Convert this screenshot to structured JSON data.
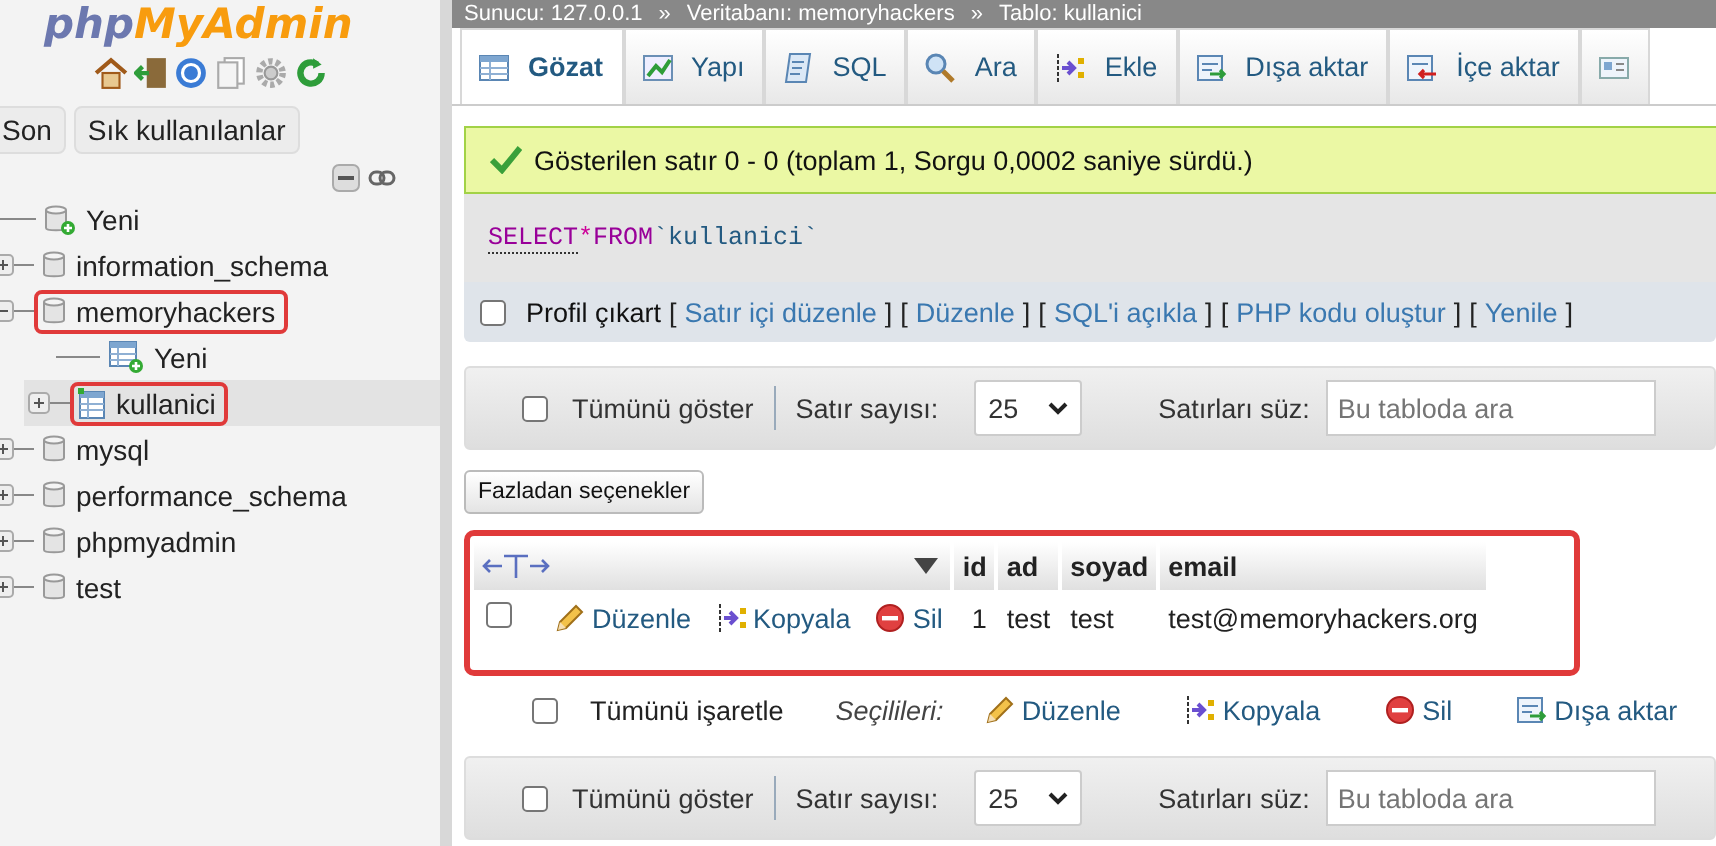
{
  "logo": [
    "php",
    "MyAdmin"
  ],
  "sidebar_buttons": [
    {
      "label": "Son"
    },
    {
      "label": "Sık kullanılanlar"
    }
  ],
  "tree": [
    {
      "label": "Yeni",
      "kind": "new",
      "highlighted": false
    },
    {
      "label": "information_schema",
      "kind": "db",
      "expanded": false,
      "highlighted": false
    },
    {
      "label": "memoryhackers",
      "kind": "db",
      "expanded": true,
      "highlighted": true,
      "children": [
        {
          "label": "Yeni",
          "kind": "new-table",
          "highlighted": false
        },
        {
          "label": "kullanici",
          "kind": "table",
          "expanded": false,
          "selected": true,
          "highlighted": true
        }
      ]
    },
    {
      "label": "mysql",
      "kind": "db",
      "expanded": false,
      "highlighted": false
    },
    {
      "label": "performance_schema",
      "kind": "db",
      "expanded": false,
      "highlighted": false
    },
    {
      "label": "phpmyadmin",
      "kind": "db",
      "expanded": false,
      "highlighted": false
    },
    {
      "label": "test",
      "kind": "db",
      "expanded": false,
      "highlighted": false
    }
  ],
  "breadcrumb": {
    "separator": "»",
    "items": [
      "Sunucu: 127.0.0.1",
      "Veritabanı: memoryhackers",
      "Tablo: kullanici"
    ]
  },
  "tabs": [
    {
      "label": "Gözat",
      "kind": "browse",
      "selected": true
    },
    {
      "label": "Yapı",
      "kind": "structure",
      "selected": false
    },
    {
      "label": "SQL",
      "kind": "sql",
      "selected": false
    },
    {
      "label": "Ara",
      "kind": "search",
      "selected": false
    },
    {
      "label": "Ekle",
      "kind": "insert",
      "selected": false
    },
    {
      "label": "Dışa aktar",
      "kind": "export",
      "selected": false
    },
    {
      "label": "İçe aktar",
      "kind": "import",
      "selected": false
    },
    {
      "kind": "card",
      "selected": false
    }
  ],
  "message": "Gösterilen satır 0 - 0 (toplam 1, Sorgu 0,0002 saniye sürdü.)",
  "sql": [
    {
      "text": "SELECT",
      "kind": "keyword"
    },
    {
      "text": "*",
      "kind": "operator"
    },
    {
      "text": "FROM",
      "kind": "keyword"
    },
    {
      "text": "`kullanici`",
      "kind": "identifier"
    }
  ],
  "profile": {
    "label": "Profil çıkart",
    "checked": false,
    "open": "[",
    "close": "]",
    "links": [
      "Satır içi düzenle",
      "Düzenle",
      "SQL'i açıkla",
      "PHP kodu oluştur",
      "Yenile"
    ]
  },
  "navigation_bars": [
    {
      "show_all": "Tümünü göster",
      "checked": false,
      "rows_label": "Satır sayısı:",
      "rows_value": "25",
      "filter_label": "Satırları süz:",
      "filter_placeholder": "Bu tabloda ara"
    },
    {
      "show_all": "Tümünü göster",
      "checked": false,
      "rows_label": "Satır sayısı:",
      "rows_value": "25",
      "filter_label": "Satırları süz:",
      "filter_placeholder": "Bu tabloda ara"
    }
  ],
  "more_options": "Fazladan seçenekler",
  "table": {
    "highlighted": true,
    "columns": [
      "id",
      "ad",
      "soyad",
      "email"
    ],
    "rows": [
      {
        "checked": false,
        "actions": [
          {
            "label": "Düzenle",
            "kind": "edit"
          },
          {
            "label": "Kopyala",
            "kind": "copy"
          },
          {
            "label": "Sil",
            "kind": "delete"
          }
        ],
        "cells": [
          "1",
          "test",
          "test",
          "test@memoryhackers.org"
        ]
      }
    ]
  },
  "bulk": {
    "check_all": "Tümünü işaretle",
    "checked": false,
    "with_selected": "Seçilileri:",
    "actions": [
      {
        "label": "Düzenle",
        "kind": "edit"
      },
      {
        "label": "Kopyala",
        "kind": "copy"
      },
      {
        "label": "Sil",
        "kind": "delete"
      },
      {
        "label": "Dışa aktar",
        "kind": "export"
      }
    ]
  }
}
